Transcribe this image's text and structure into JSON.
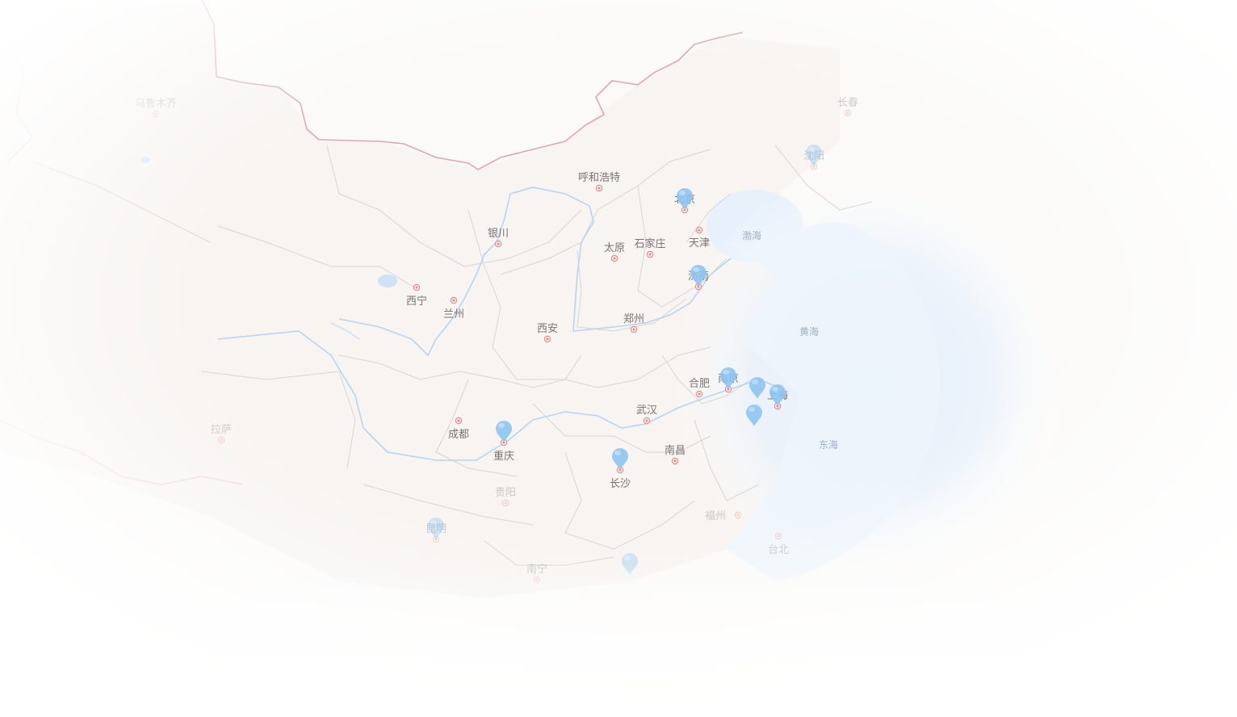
{
  "map": {
    "type": "china-map",
    "colors": {
      "land": "#f7f5f2",
      "sea": "#e7f0fb",
      "border": "#dca7b3",
      "river": "#b7d4f3",
      "city_dot": "#e98a8a",
      "marker": "#8ec5f2"
    },
    "cities": [
      {
        "id": "urumqi",
        "name": "乌鲁木齐",
        "dim": true
      },
      {
        "id": "changchun",
        "name": "长春",
        "dim": true
      },
      {
        "id": "shenyang",
        "name": "沈阳",
        "dim": true
      },
      {
        "id": "hohhot",
        "name": "呼和浩特",
        "dim": false
      },
      {
        "id": "beijing",
        "name": "北京",
        "dim": false
      },
      {
        "id": "yinchuan",
        "name": "银川",
        "dim": false
      },
      {
        "id": "taiyuan",
        "name": "太原",
        "dim": false
      },
      {
        "id": "shijiazhuang",
        "name": "石家庄",
        "dim": false
      },
      {
        "id": "tianjin",
        "name": "天津",
        "dim": false
      },
      {
        "id": "jinan",
        "name": "济南",
        "dim": false
      },
      {
        "id": "xining",
        "name": "西宁",
        "dim": false
      },
      {
        "id": "lanzhou",
        "name": "兰州",
        "dim": false
      },
      {
        "id": "xian",
        "name": "西安",
        "dim": false
      },
      {
        "id": "zhengzhou",
        "name": "郑州",
        "dim": false
      },
      {
        "id": "hefei",
        "name": "合肥",
        "dim": false
      },
      {
        "id": "nanjing",
        "name": "南京",
        "dim": false
      },
      {
        "id": "shanghai",
        "name": "上海",
        "dim": false
      },
      {
        "id": "wuhan",
        "name": "武汉",
        "dim": false
      },
      {
        "id": "chengdu",
        "name": "成都",
        "dim": false
      },
      {
        "id": "chongqing",
        "name": "重庆",
        "dim": false
      },
      {
        "id": "lhasa",
        "name": "拉萨",
        "dim": true
      },
      {
        "id": "nanchang",
        "name": "南昌",
        "dim": false
      },
      {
        "id": "changsha",
        "name": "长沙",
        "dim": false
      },
      {
        "id": "guiyang",
        "name": "贵阳",
        "dim": true
      },
      {
        "id": "fuzhou",
        "name": "福州",
        "dim": true
      },
      {
        "id": "kunming",
        "name": "昆明",
        "dim": true
      },
      {
        "id": "taipei",
        "name": "台北",
        "dim": true
      },
      {
        "id": "nanning",
        "name": "南宁",
        "dim": true
      }
    ],
    "seas": [
      {
        "id": "bohai",
        "name": "渤海"
      },
      {
        "id": "huanghai",
        "name": "黄海"
      },
      {
        "id": "donghai",
        "name": "东海"
      }
    ],
    "markers": [
      {
        "city": "beijing",
        "faded": false
      },
      {
        "city": "jinan",
        "faded": false
      },
      {
        "city": "nanjing",
        "faded": false
      },
      {
        "city": "suzhou",
        "faded": false
      },
      {
        "city": "shanghai",
        "faded": false
      },
      {
        "city": "hangzhou",
        "faded": false
      },
      {
        "city": "chongqing",
        "faded": false
      },
      {
        "city": "changsha",
        "faded": false
      },
      {
        "city": "shenyang",
        "faded": true
      },
      {
        "city": "kunming",
        "faded": true
      },
      {
        "city": "guangzhou",
        "faded": true
      }
    ]
  }
}
